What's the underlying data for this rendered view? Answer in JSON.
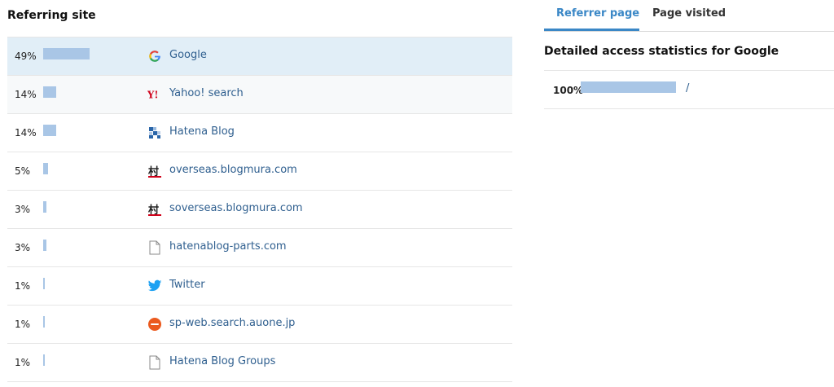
{
  "left": {
    "title": "Referring site",
    "rows": [
      {
        "pct": "49%",
        "value": 49,
        "icon": "google-icon",
        "label": "Google",
        "selected": true
      },
      {
        "pct": "14%",
        "value": 14,
        "icon": "yahoo-icon",
        "label": "Yahoo! search"
      },
      {
        "pct": "14%",
        "value": 14,
        "icon": "hatena-blog-icon",
        "label": "Hatena Blog"
      },
      {
        "pct": "5%",
        "value": 5,
        "icon": "blogmura-icon",
        "label": "overseas.blogmura.com"
      },
      {
        "pct": "3%",
        "value": 3,
        "icon": "blogmura-icon",
        "label": "soverseas.blogmura.com"
      },
      {
        "pct": "3%",
        "value": 3,
        "icon": "page-icon",
        "label": "hatenablog-parts.com"
      },
      {
        "pct": "1%",
        "value": 1,
        "icon": "twitter-icon",
        "label": "Twitter"
      },
      {
        "pct": "1%",
        "value": 1,
        "icon": "au-search-icon",
        "label": "sp-web.search.auone.jp"
      },
      {
        "pct": "1%",
        "value": 1,
        "icon": "page-icon",
        "label": "Hatena Blog Groups"
      }
    ]
  },
  "right": {
    "tabs": [
      {
        "label": "Referrer page",
        "active": true
      },
      {
        "label": "Page visited",
        "active": false
      }
    ],
    "detail_title": "Detailed access statistics for Google",
    "detail_rows": [
      {
        "pct": "100%",
        "value": 100,
        "label": "/"
      }
    ]
  },
  "colors": {
    "bar": "#a9c6e6",
    "selected_row": "#e1eef7",
    "link": "#2f5f8f",
    "active_tab": "#3a87c6"
  }
}
